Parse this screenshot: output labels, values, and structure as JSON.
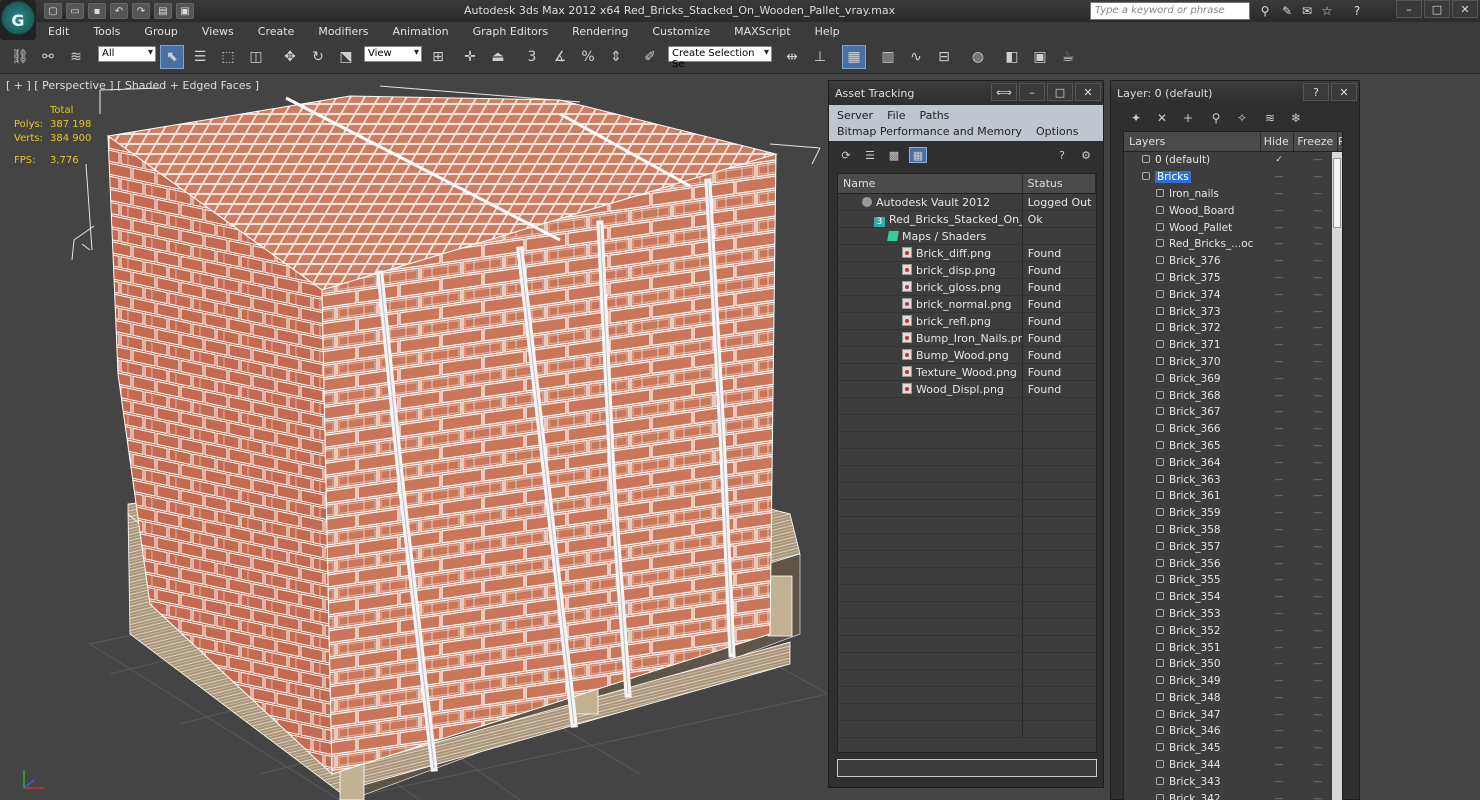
{
  "app": {
    "title": "Autodesk 3ds Max  2012 x64     Red_Bricks_Stacked_On_Wooden_Pallet_vray.max",
    "search_placeholder": "Type a keyword or phrase"
  },
  "menubar": [
    "Edit",
    "Tools",
    "Group",
    "Views",
    "Create",
    "Modifiers",
    "Animation",
    "Graph Editors",
    "Rendering",
    "Customize",
    "MAXScript",
    "Help"
  ],
  "toolbar": {
    "selection_filter": "All",
    "ref_coord": "View",
    "named_selection": "Create Selection Se"
  },
  "viewport": {
    "label": "[ + ] [ Perspective ] [ Shaded + Edged Faces ]",
    "stats": {
      "header": "Total",
      "polys_label": "Polys:",
      "polys_value": "387 198",
      "verts_label": "Verts:",
      "verts_value": "384 900",
      "fps_label": "FPS:",
      "fps_value": "3,776"
    }
  },
  "asset_tracking": {
    "title": "Asset Tracking",
    "menus_row1": [
      "Server",
      "File",
      "Paths"
    ],
    "menus_row2": [
      "Bitmap Performance and Memory",
      "Options"
    ],
    "columns": [
      "Name",
      "Status"
    ],
    "rows": [
      {
        "name": "Autodesk Vault 2012",
        "status": "Logged Out ...",
        "indent": 24,
        "icon": "vault"
      },
      {
        "name": "Red_Bricks_Stacked_On_W...",
        "status": "Ok",
        "indent": 36,
        "icon": "three"
      },
      {
        "name": "Maps / Shaders",
        "status": "",
        "indent": 50,
        "icon": "green"
      },
      {
        "name": "Brick_diff.png",
        "status": "Found",
        "indent": 64,
        "icon": "file"
      },
      {
        "name": "brick_disp.png",
        "status": "Found",
        "indent": 64,
        "icon": "file"
      },
      {
        "name": "brick_gloss.png",
        "status": "Found",
        "indent": 64,
        "icon": "file"
      },
      {
        "name": "brick_normal.png",
        "status": "Found",
        "indent": 64,
        "icon": "file"
      },
      {
        "name": "brick_refl.png",
        "status": "Found",
        "indent": 64,
        "icon": "file"
      },
      {
        "name": "Bump_Iron_Nails.png",
        "status": "Found",
        "indent": 64,
        "icon": "file"
      },
      {
        "name": "Bump_Wood.png",
        "status": "Found",
        "indent": 64,
        "icon": "file"
      },
      {
        "name": "Texture_Wood.png",
        "status": "Found",
        "indent": 64,
        "icon": "file"
      },
      {
        "name": "Wood_Displ.png",
        "status": "Found",
        "indent": 64,
        "icon": "file"
      }
    ]
  },
  "layer_win": {
    "title": "Layer: 0 (default)",
    "columns": [
      "Layers",
      "Hide",
      "Freeze",
      "R"
    ],
    "rows": [
      {
        "name": "0 (default)",
        "indent": 18,
        "kind": "layer",
        "check": true
      },
      {
        "name": "Bricks",
        "indent": 18,
        "kind": "layer",
        "selected": true
      },
      {
        "name": "Iron_nails",
        "indent": 32,
        "kind": "obj"
      },
      {
        "name": "Wood_Board",
        "indent": 32,
        "kind": "obj"
      },
      {
        "name": "Wood_Pallet",
        "indent": 32,
        "kind": "obj"
      },
      {
        "name": "Red_Bricks_...oc",
        "indent": 32,
        "kind": "obj"
      },
      {
        "name": "Brick_376",
        "indent": 32,
        "kind": "obj"
      },
      {
        "name": "Brick_375",
        "indent": 32,
        "kind": "obj"
      },
      {
        "name": "Brick_374",
        "indent": 32,
        "kind": "obj"
      },
      {
        "name": "Brick_373",
        "indent": 32,
        "kind": "obj"
      },
      {
        "name": "Brick_372",
        "indent": 32,
        "kind": "obj"
      },
      {
        "name": "Brick_371",
        "indent": 32,
        "kind": "obj"
      },
      {
        "name": "Brick_370",
        "indent": 32,
        "kind": "obj"
      },
      {
        "name": "Brick_369",
        "indent": 32,
        "kind": "obj"
      },
      {
        "name": "Brick_368",
        "indent": 32,
        "kind": "obj"
      },
      {
        "name": "Brick_367",
        "indent": 32,
        "kind": "obj"
      },
      {
        "name": "Brick_366",
        "indent": 32,
        "kind": "obj"
      },
      {
        "name": "Brick_365",
        "indent": 32,
        "kind": "obj"
      },
      {
        "name": "Brick_364",
        "indent": 32,
        "kind": "obj"
      },
      {
        "name": "Brick_363",
        "indent": 32,
        "kind": "obj"
      },
      {
        "name": "Brick_361",
        "indent": 32,
        "kind": "obj"
      },
      {
        "name": "Brick_359",
        "indent": 32,
        "kind": "obj"
      },
      {
        "name": "Brick_358",
        "indent": 32,
        "kind": "obj"
      },
      {
        "name": "Brick_357",
        "indent": 32,
        "kind": "obj"
      },
      {
        "name": "Brick_356",
        "indent": 32,
        "kind": "obj"
      },
      {
        "name": "Brick_355",
        "indent": 32,
        "kind": "obj"
      },
      {
        "name": "Brick_354",
        "indent": 32,
        "kind": "obj"
      },
      {
        "name": "Brick_353",
        "indent": 32,
        "kind": "obj"
      },
      {
        "name": "Brick_352",
        "indent": 32,
        "kind": "obj"
      },
      {
        "name": "Brick_351",
        "indent": 32,
        "kind": "obj"
      },
      {
        "name": "Brick_350",
        "indent": 32,
        "kind": "obj"
      },
      {
        "name": "Brick_349",
        "indent": 32,
        "kind": "obj"
      },
      {
        "name": "Brick_348",
        "indent": 32,
        "kind": "obj"
      },
      {
        "name": "Brick_347",
        "indent": 32,
        "kind": "obj"
      },
      {
        "name": "Brick_346",
        "indent": 32,
        "kind": "obj"
      },
      {
        "name": "Brick_345",
        "indent": 32,
        "kind": "obj"
      },
      {
        "name": "Brick_344",
        "indent": 32,
        "kind": "obj"
      },
      {
        "name": "Brick_343",
        "indent": 32,
        "kind": "obj"
      },
      {
        "name": "Brick_342",
        "indent": 32,
        "kind": "obj"
      }
    ]
  },
  "colors": {
    "brick": "#c4694e",
    "wireframe": "#ffffff",
    "wood": "#b9a98c",
    "stats": "#e4c81c",
    "selection": "#2f6fd6"
  }
}
